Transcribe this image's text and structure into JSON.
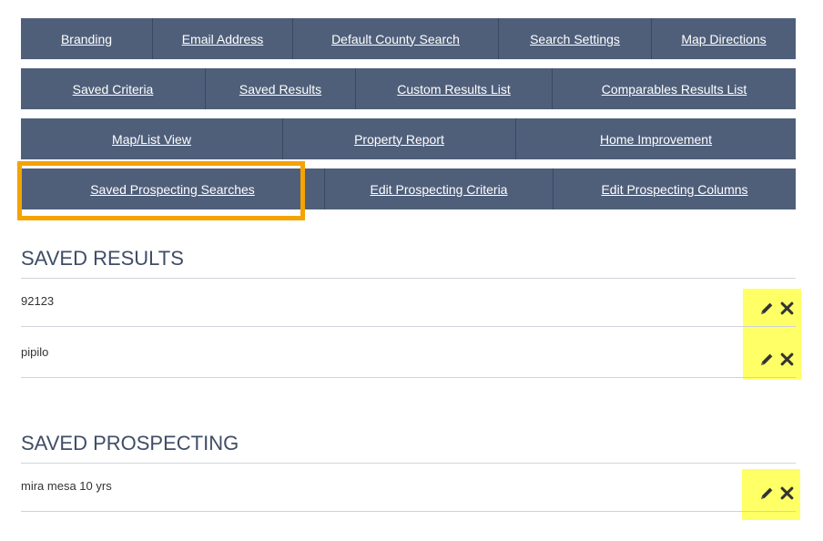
{
  "tabs": {
    "row1": [
      "Branding",
      "Email Address",
      "Default County Search",
      "Search Settings",
      "Map Directions"
    ],
    "row2": [
      "Saved Criteria",
      "Saved Results",
      "Custom Results List",
      "Comparables Results List"
    ],
    "row3": [
      "Map/List View",
      "Property Report",
      "Home Improvement"
    ],
    "row4": [
      "Saved Prospecting Searches",
      "Edit Prospecting Criteria",
      "Edit Prospecting Columns"
    ]
  },
  "saved_results": {
    "title": "SAVED RESULTS",
    "items": [
      "92123",
      "pipilo"
    ]
  },
  "saved_prospecting": {
    "title": "SAVED PROSPECTING",
    "items": [
      "mira mesa 10 yrs"
    ]
  },
  "colors": {
    "tab_bg": "#4f5f7a",
    "highlight": "#f4a300",
    "marker": "#ffff66"
  },
  "icons": [
    "pencil-icon",
    "close-icon"
  ]
}
